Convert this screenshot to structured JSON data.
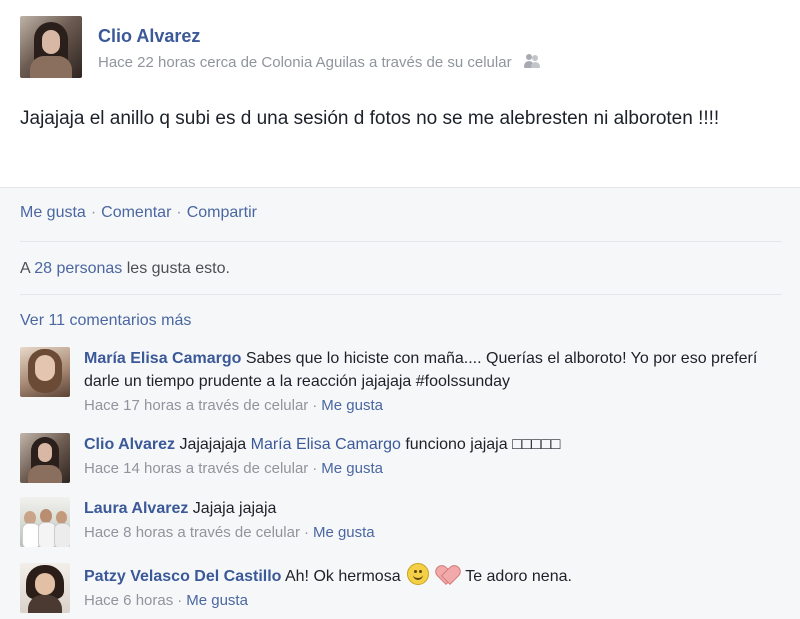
{
  "post": {
    "author": "Clio Alvarez",
    "meta": "Hace 22 horas cerca de Colonia Aguilas a través de su celular",
    "text": "Jajajaja el anillo q subi es d una sesión d fotos no se me alebresten ni alboroten !!!!",
    "audience_icon": "friends-icon"
  },
  "actions": {
    "like": "Me gusta",
    "comment": "Comentar",
    "share": "Compartir",
    "separator": "·"
  },
  "likes": {
    "prefix": "A ",
    "count_link": "28 personas",
    "suffix": " les gusta esto."
  },
  "view_more": "Ver 11 comentarios más",
  "comments": [
    {
      "name": "María Elisa Camargo",
      "text": " Sabes que lo hiciste con maña.... Querías el alboroto! Yo por eso preferí darle un tiempo prudente a la reacción jajajaja #foolssunday",
      "time": "Hace 17 horas a través de celular",
      "like": "Me gusta"
    },
    {
      "name": "Clio Alvarez",
      "text_before": " Jajajajaja ",
      "mention": "María Elisa Camargo",
      "text_after": " funciono jajaja □□□□□",
      "time": "Hace 14 horas a través de celular",
      "like": "Me gusta"
    },
    {
      "name": "Laura Alvarez",
      "text": " Jajaja jajaja",
      "time": "Hace 8 horas a través de celular",
      "like": "Me gusta"
    },
    {
      "name": "Patzy Velasco Del Castillo",
      "text_before": " Ah! Ok hermosa ",
      "text_after": " Te adoro nena.",
      "time": "Hace 6 horas",
      "like": "Me gusta",
      "emoticons": [
        "smiley-icon",
        "heart-icon"
      ]
    }
  ]
}
